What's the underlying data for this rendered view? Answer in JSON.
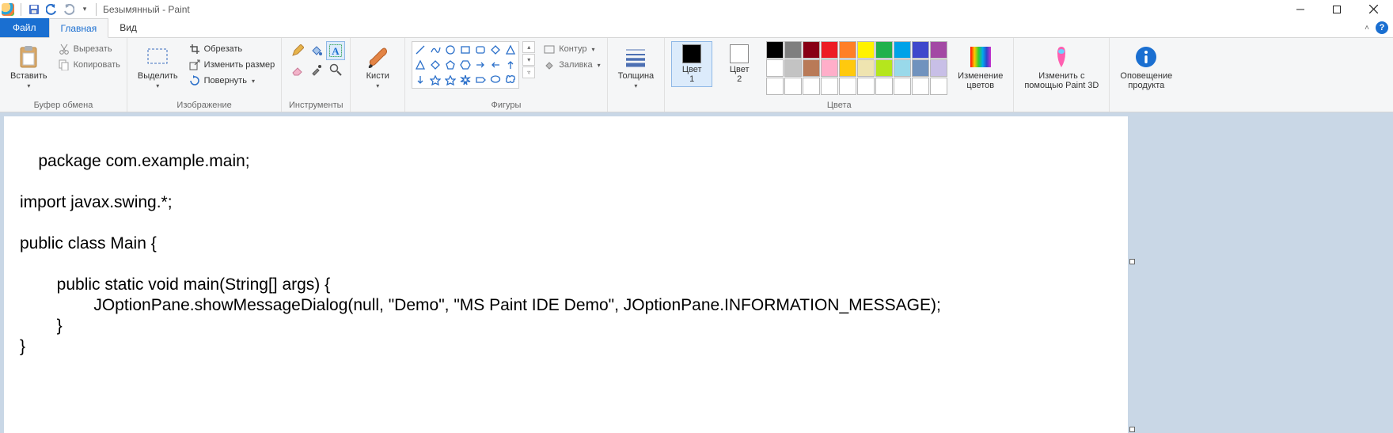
{
  "title": "Безымянный - Paint",
  "tabs": {
    "file": "Файл",
    "home": "Главная",
    "view": "Вид"
  },
  "clipboard": {
    "paste": "Вставить",
    "cut": "Вырезать",
    "copy": "Копировать",
    "group": "Буфер обмена"
  },
  "image": {
    "select": "Выделить",
    "crop": "Обрезать",
    "resize": "Изменить размер",
    "rotate": "Повернуть",
    "group": "Изображение"
  },
  "tools": {
    "group": "Инструменты",
    "icons": [
      "pencil",
      "fill",
      "text",
      "eraser",
      "picker",
      "zoom"
    ]
  },
  "brushes": {
    "label": "Кисти"
  },
  "shapes": {
    "outline": "Контур",
    "fill": "Заливка",
    "group": "Фигуры"
  },
  "stroke": {
    "label": "Толщина"
  },
  "colors": {
    "color1": "Цвет\n1",
    "color2": "Цвет\n2",
    "color1_value": "#000000",
    "color2_value": "#ffffff",
    "edit": "Изменение\nцветов",
    "group": "Цвета",
    "row1": [
      "#000000",
      "#7f7f7f",
      "#880015",
      "#ed1c24",
      "#ff7f27",
      "#fff200",
      "#22b14c",
      "#00a2e8",
      "#3f48cc",
      "#a349a4"
    ],
    "row2": [
      "#ffffff",
      "#c3c3c3",
      "#b97a57",
      "#ffaec9",
      "#ffc90e",
      "#efe4b0",
      "#b5e61d",
      "#99d9ea",
      "#7092be",
      "#c8bfe7"
    ],
    "row3": [
      "#ffffff",
      "#ffffff",
      "#ffffff",
      "#ffffff",
      "#ffffff",
      "#ffffff",
      "#ffffff",
      "#ffffff",
      "#ffffff",
      "#ffffff"
    ]
  },
  "paint3d": {
    "label": "Изменить с\nпомощью Paint 3D"
  },
  "notice": {
    "label": "Оповещение\nпродукта"
  },
  "canvas_text": "package com.example.main;\n\nimport javax.swing.*;\n\npublic class Main {\n\n        public static void main(String[] args) {\n                JOptionPane.showMessageDialog(null, \"Demo\", \"MS Paint IDE Demo\", JOptionPane.INFORMATION_MESSAGE);\n        }\n}"
}
